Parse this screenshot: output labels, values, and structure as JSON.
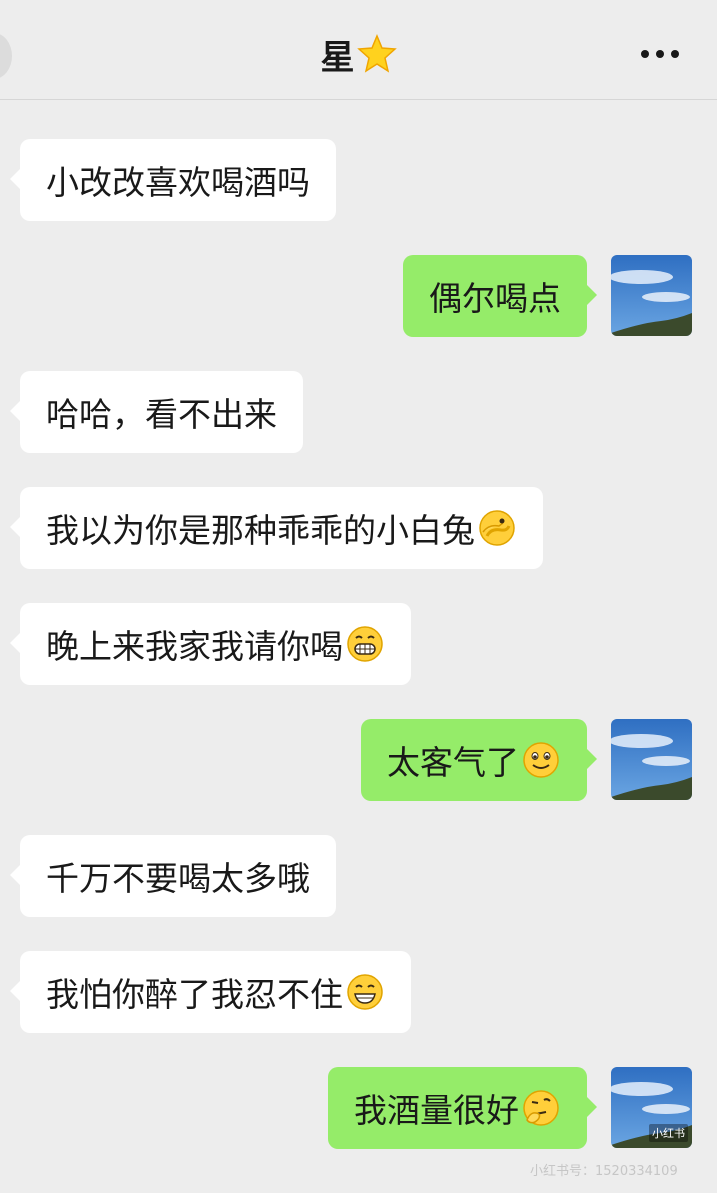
{
  "header": {
    "title": "星",
    "title_icon": "star-icon"
  },
  "messages": [
    {
      "side": "left",
      "text": "小改改喜欢喝酒吗"
    },
    {
      "side": "right",
      "text": "偶尔喝点"
    },
    {
      "side": "left",
      "text": "哈哈，看不出来"
    },
    {
      "side": "left",
      "text": "我以为你是那种乖乖的小白兔",
      "emoji": "facepalm-emoji"
    },
    {
      "side": "left",
      "text": "晚上来我家我请你喝",
      "emoji": "grin-teeth-emoji"
    },
    {
      "side": "right",
      "text": "太客气了",
      "emoji": "smile-emoji"
    },
    {
      "side": "left",
      "text": "千万不要喝太多哦"
    },
    {
      "side": "left",
      "text": "我怕你醉了我忍不住",
      "emoji": "grin-emoji"
    },
    {
      "side": "right",
      "text": "我酒量很好",
      "emoji": "thinking-emoji"
    }
  ],
  "avatar_tag": "小红书",
  "watermark": "小红书号：1520334109",
  "colors": {
    "background": "#ededed",
    "sent_bubble": "#95ec69",
    "received_bubble": "#ffffff"
  }
}
